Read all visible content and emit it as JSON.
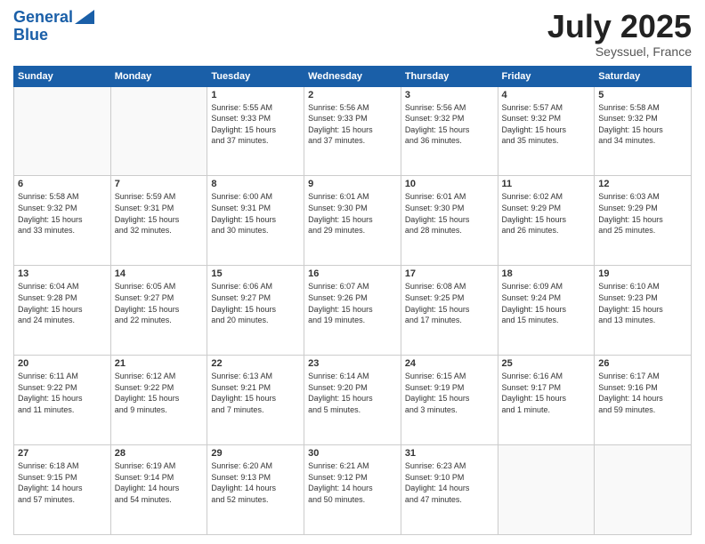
{
  "header": {
    "logo_line1": "General",
    "logo_line2": "Blue",
    "month": "July 2025",
    "location": "Seyssuel, France"
  },
  "weekdays": [
    "Sunday",
    "Monday",
    "Tuesday",
    "Wednesday",
    "Thursday",
    "Friday",
    "Saturday"
  ],
  "weeks": [
    [
      {
        "day": "",
        "info": ""
      },
      {
        "day": "",
        "info": ""
      },
      {
        "day": "1",
        "info": "Sunrise: 5:55 AM\nSunset: 9:33 PM\nDaylight: 15 hours\nand 37 minutes."
      },
      {
        "day": "2",
        "info": "Sunrise: 5:56 AM\nSunset: 9:33 PM\nDaylight: 15 hours\nand 37 minutes."
      },
      {
        "day": "3",
        "info": "Sunrise: 5:56 AM\nSunset: 9:32 PM\nDaylight: 15 hours\nand 36 minutes."
      },
      {
        "day": "4",
        "info": "Sunrise: 5:57 AM\nSunset: 9:32 PM\nDaylight: 15 hours\nand 35 minutes."
      },
      {
        "day": "5",
        "info": "Sunrise: 5:58 AM\nSunset: 9:32 PM\nDaylight: 15 hours\nand 34 minutes."
      }
    ],
    [
      {
        "day": "6",
        "info": "Sunrise: 5:58 AM\nSunset: 9:32 PM\nDaylight: 15 hours\nand 33 minutes."
      },
      {
        "day": "7",
        "info": "Sunrise: 5:59 AM\nSunset: 9:31 PM\nDaylight: 15 hours\nand 32 minutes."
      },
      {
        "day": "8",
        "info": "Sunrise: 6:00 AM\nSunset: 9:31 PM\nDaylight: 15 hours\nand 30 minutes."
      },
      {
        "day": "9",
        "info": "Sunrise: 6:01 AM\nSunset: 9:30 PM\nDaylight: 15 hours\nand 29 minutes."
      },
      {
        "day": "10",
        "info": "Sunrise: 6:01 AM\nSunset: 9:30 PM\nDaylight: 15 hours\nand 28 minutes."
      },
      {
        "day": "11",
        "info": "Sunrise: 6:02 AM\nSunset: 9:29 PM\nDaylight: 15 hours\nand 26 minutes."
      },
      {
        "day": "12",
        "info": "Sunrise: 6:03 AM\nSunset: 9:29 PM\nDaylight: 15 hours\nand 25 minutes."
      }
    ],
    [
      {
        "day": "13",
        "info": "Sunrise: 6:04 AM\nSunset: 9:28 PM\nDaylight: 15 hours\nand 24 minutes."
      },
      {
        "day": "14",
        "info": "Sunrise: 6:05 AM\nSunset: 9:27 PM\nDaylight: 15 hours\nand 22 minutes."
      },
      {
        "day": "15",
        "info": "Sunrise: 6:06 AM\nSunset: 9:27 PM\nDaylight: 15 hours\nand 20 minutes."
      },
      {
        "day": "16",
        "info": "Sunrise: 6:07 AM\nSunset: 9:26 PM\nDaylight: 15 hours\nand 19 minutes."
      },
      {
        "day": "17",
        "info": "Sunrise: 6:08 AM\nSunset: 9:25 PM\nDaylight: 15 hours\nand 17 minutes."
      },
      {
        "day": "18",
        "info": "Sunrise: 6:09 AM\nSunset: 9:24 PM\nDaylight: 15 hours\nand 15 minutes."
      },
      {
        "day": "19",
        "info": "Sunrise: 6:10 AM\nSunset: 9:23 PM\nDaylight: 15 hours\nand 13 minutes."
      }
    ],
    [
      {
        "day": "20",
        "info": "Sunrise: 6:11 AM\nSunset: 9:22 PM\nDaylight: 15 hours\nand 11 minutes."
      },
      {
        "day": "21",
        "info": "Sunrise: 6:12 AM\nSunset: 9:22 PM\nDaylight: 15 hours\nand 9 minutes."
      },
      {
        "day": "22",
        "info": "Sunrise: 6:13 AM\nSunset: 9:21 PM\nDaylight: 15 hours\nand 7 minutes."
      },
      {
        "day": "23",
        "info": "Sunrise: 6:14 AM\nSunset: 9:20 PM\nDaylight: 15 hours\nand 5 minutes."
      },
      {
        "day": "24",
        "info": "Sunrise: 6:15 AM\nSunset: 9:19 PM\nDaylight: 15 hours\nand 3 minutes."
      },
      {
        "day": "25",
        "info": "Sunrise: 6:16 AM\nSunset: 9:17 PM\nDaylight: 15 hours\nand 1 minute."
      },
      {
        "day": "26",
        "info": "Sunrise: 6:17 AM\nSunset: 9:16 PM\nDaylight: 14 hours\nand 59 minutes."
      }
    ],
    [
      {
        "day": "27",
        "info": "Sunrise: 6:18 AM\nSunset: 9:15 PM\nDaylight: 14 hours\nand 57 minutes."
      },
      {
        "day": "28",
        "info": "Sunrise: 6:19 AM\nSunset: 9:14 PM\nDaylight: 14 hours\nand 54 minutes."
      },
      {
        "day": "29",
        "info": "Sunrise: 6:20 AM\nSunset: 9:13 PM\nDaylight: 14 hours\nand 52 minutes."
      },
      {
        "day": "30",
        "info": "Sunrise: 6:21 AM\nSunset: 9:12 PM\nDaylight: 14 hours\nand 50 minutes."
      },
      {
        "day": "31",
        "info": "Sunrise: 6:23 AM\nSunset: 9:10 PM\nDaylight: 14 hours\nand 47 minutes."
      },
      {
        "day": "",
        "info": ""
      },
      {
        "day": "",
        "info": ""
      }
    ]
  ]
}
